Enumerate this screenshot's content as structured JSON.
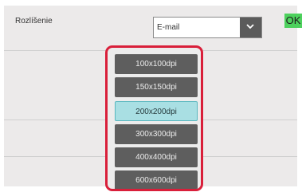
{
  "header": {
    "title": "Rozlíšenie",
    "ok_label": "OK"
  },
  "mode_select": {
    "value": "E-mail"
  },
  "resolution_options": [
    {
      "label": "100x100dpi",
      "selected": false
    },
    {
      "label": "150x150dpi",
      "selected": false
    },
    {
      "label": "200x200dpi",
      "selected": true
    },
    {
      "label": "300x300dpi",
      "selected": false
    },
    {
      "label": "400x400dpi",
      "selected": false
    },
    {
      "label": "600x600dpi",
      "selected": false
    }
  ],
  "colors": {
    "highlight_border": "#d91f3a",
    "ok_green": "#4dd15d",
    "selected_bg": "#a9dfe3",
    "option_bg": "#5e5e5e"
  }
}
